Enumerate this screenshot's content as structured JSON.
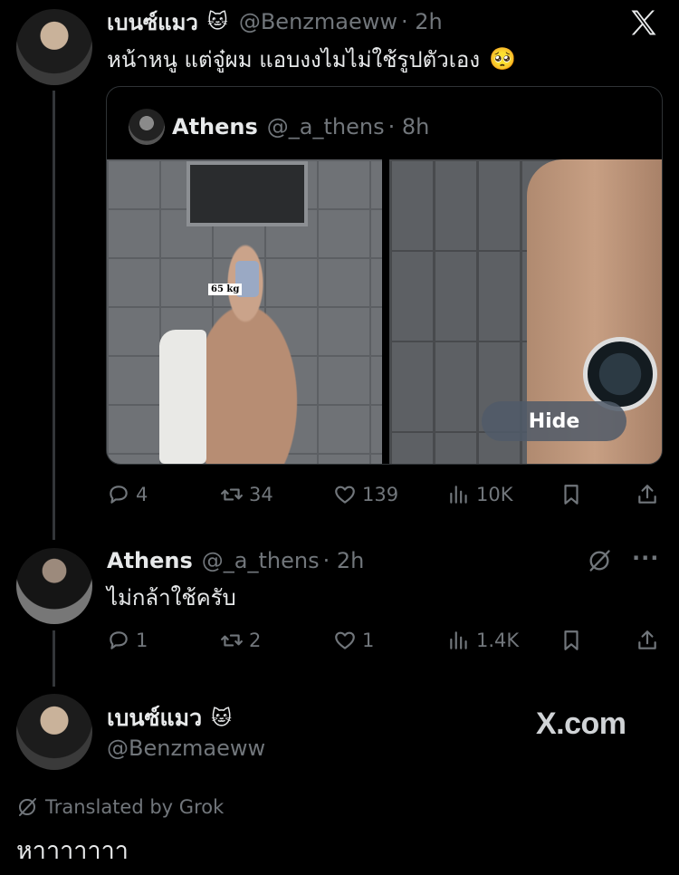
{
  "post": {
    "display_name": "เบนซ์แมว",
    "name_emoji": "🐱",
    "handle": "@Benzmaeww",
    "time": "· 2h",
    "text": "หน้าหนู แต่จู๋ผม แอบงงไมไม่ใช้รูปตัวเอง",
    "text_emoji": "🥺"
  },
  "quote": {
    "display_name": "Athens",
    "handle": "@_a_thens",
    "time": "· 8h",
    "photo_tag": "65 kg",
    "hide_label": "Hide"
  },
  "post_actions": {
    "replies": "4",
    "reposts": "34",
    "likes": "139",
    "views": "10K"
  },
  "reply": {
    "display_name": "Athens",
    "handle": "@_a_thens",
    "time": "· 2h",
    "text": "ไม่กล้าใช้ครับ",
    "more": "···"
  },
  "reply_actions": {
    "replies": "1",
    "reposts": "2",
    "likes": "1",
    "views": "1.4K"
  },
  "footer": {
    "display_name": "เบนซ์แมว",
    "name_emoji": "🐱",
    "handle": "@Benzmaeww",
    "brand": "X.com",
    "translated_label": "Translated by Grok",
    "translated_text": "หาาาาาาา"
  },
  "icons": {
    "x_logo": "x-logo-icon",
    "reply": "reply-icon",
    "repost": "repost-icon",
    "like": "heart-icon",
    "views": "views-icon",
    "bookmark": "bookmark-icon",
    "share": "share-icon",
    "grok": "grok-icon"
  },
  "colors": {
    "background": "#000000",
    "text": "#e7e9ea",
    "muted": "#71767b",
    "border": "#2f3336"
  }
}
